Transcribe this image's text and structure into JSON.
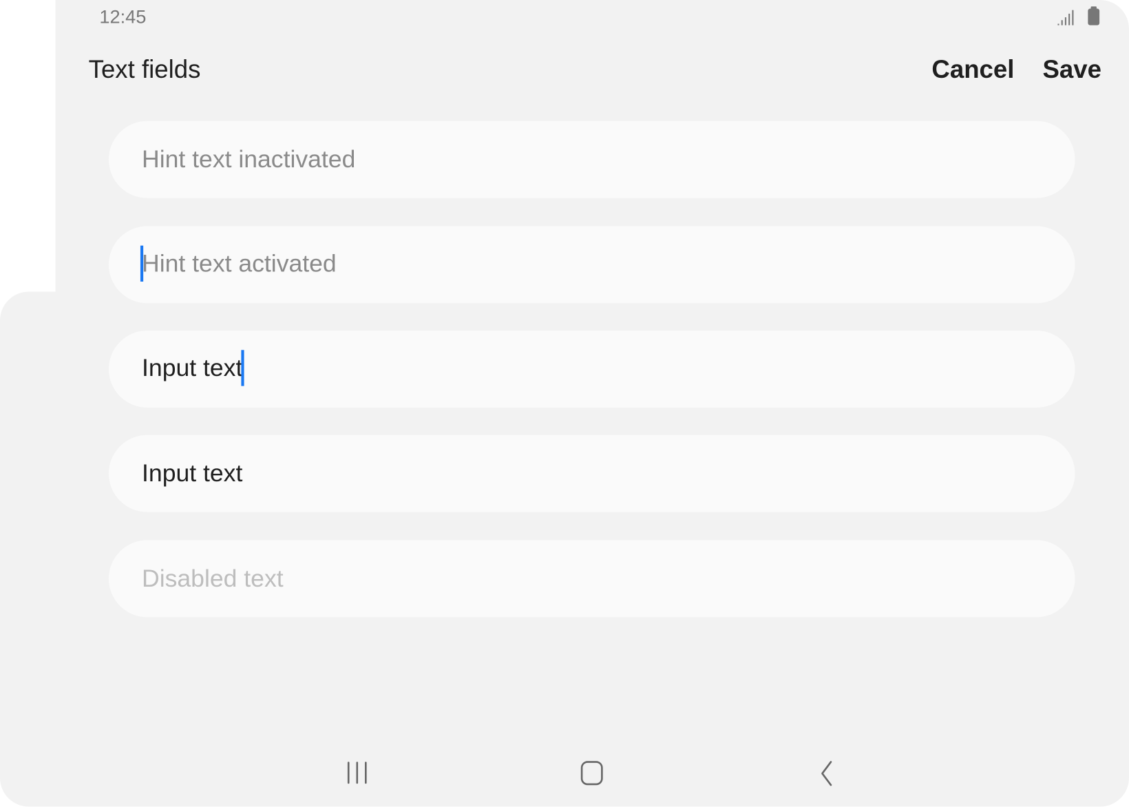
{
  "status_bar": {
    "time": "12:45",
    "signal_icon": "signal-icon",
    "battery_icon": "battery-icon"
  },
  "header": {
    "title": "Text fields",
    "cancel_label": "Cancel",
    "save_label": "Save"
  },
  "fields": [
    {
      "state": "hint-inactive",
      "text": "Hint text inactivated"
    },
    {
      "state": "hint-active",
      "text": "Hint text activated"
    },
    {
      "state": "input-focused",
      "text": "Input text"
    },
    {
      "state": "input",
      "text": "Input text"
    },
    {
      "state": "disabled",
      "text": "Disabled text"
    }
  ],
  "colors": {
    "accent": "#1a78f2",
    "background": "#f2f2f2",
    "field": "#fafafa"
  },
  "nav_bar": {
    "icons": [
      "recents-icon",
      "home-icon",
      "back-icon"
    ]
  }
}
